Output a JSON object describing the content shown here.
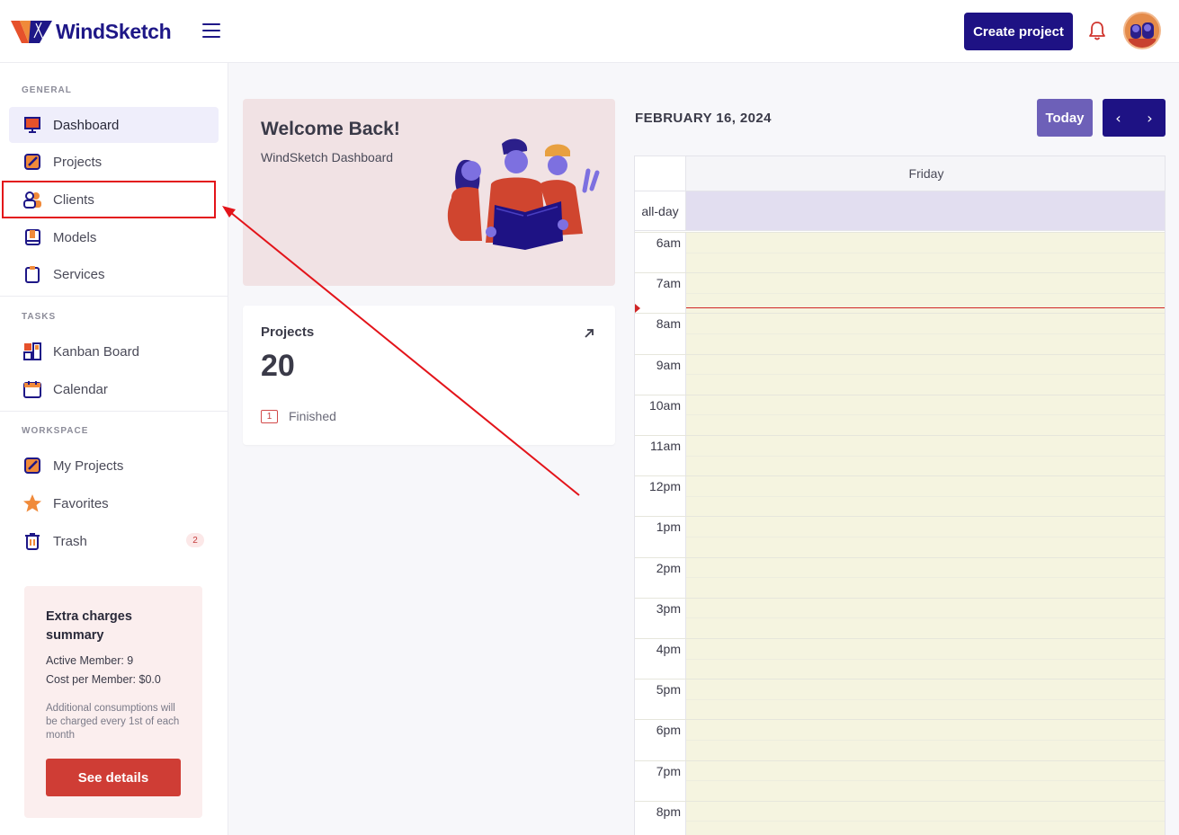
{
  "header": {
    "brand": "WindSketch",
    "create_label": "Create project"
  },
  "sidebar": {
    "sections": {
      "general": "GENERAL",
      "tasks": "TASKS",
      "workspace": "WORKSPACE"
    },
    "items": [
      {
        "label": "Dashboard",
        "icon": "monitor-icon",
        "active": true
      },
      {
        "label": "Projects",
        "icon": "edit-board-icon"
      },
      {
        "label": "Clients",
        "icon": "users-icon"
      },
      {
        "label": "Models",
        "icon": "book-icon"
      },
      {
        "label": "Services",
        "icon": "clipboard-icon"
      },
      {
        "label": "Kanban Board",
        "icon": "kanban-icon"
      },
      {
        "label": "Calendar",
        "icon": "calendar-icon"
      },
      {
        "label": "My Projects",
        "icon": "edit-board-icon"
      },
      {
        "label": "Favorites",
        "icon": "star-icon"
      },
      {
        "label": "Trash",
        "icon": "trash-icon",
        "badge": "2"
      }
    ],
    "charges": {
      "title": "Extra charges summary",
      "active_members": "Active Member: 9",
      "cost_per_member": "Cost per Member: $0.0",
      "note": "Additional consumptions will be charged every 1st of each month",
      "button": "See details"
    }
  },
  "welcome": {
    "title": "Welcome Back!",
    "subtitle": "WindSketch Dashboard"
  },
  "projects_card": {
    "title": "Projects",
    "count": "20",
    "finished_count": "1",
    "finished_label": "Finished"
  },
  "calendar": {
    "date": "FEBRUARY 16, 2024",
    "today_label": "Today",
    "prev": "‹",
    "next": "›",
    "day_label": "Friday",
    "allday_label": "all-day",
    "hours": [
      "6am",
      "7am",
      "8am",
      "9am",
      "10am",
      "11am",
      "12pm",
      "1pm",
      "2pm",
      "3pm",
      "4pm",
      "5pm",
      "6pm",
      "7pm",
      "8pm"
    ]
  },
  "colors": {
    "brand": "#1e1284",
    "accent": "#cf3d35",
    "highlight": "#e3141a"
  }
}
